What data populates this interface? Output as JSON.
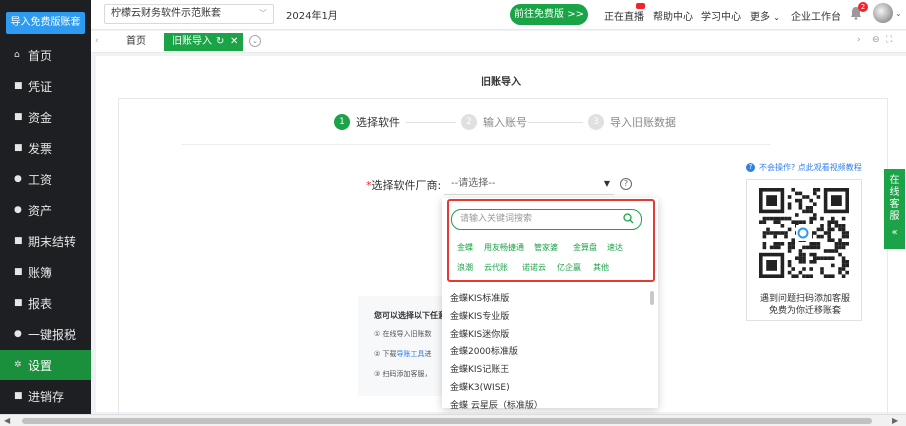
{
  "sidebar": {
    "import_button": "导入免费版账套",
    "items": [
      {
        "label": "首页",
        "icon": "home-icon",
        "glyph": "⌂"
      },
      {
        "label": "凭证",
        "icon": "voucher-icon",
        "glyph": "■"
      },
      {
        "label": "资金",
        "icon": "funds-icon",
        "glyph": "■"
      },
      {
        "label": "发票",
        "icon": "invoice-icon",
        "glyph": "■"
      },
      {
        "label": "工资",
        "icon": "salary-icon",
        "glyph": "●"
      },
      {
        "label": "资产",
        "icon": "assets-icon",
        "glyph": "●"
      },
      {
        "label": "期末结转",
        "icon": "period-end-icon",
        "glyph": "■"
      },
      {
        "label": "账簿",
        "icon": "ledger-icon",
        "glyph": "■"
      },
      {
        "label": "报表",
        "icon": "report-icon",
        "glyph": "■"
      },
      {
        "label": "一键报税",
        "icon": "tax-icon",
        "glyph": "●"
      },
      {
        "label": "设置",
        "icon": "settings-icon",
        "glyph": "✲",
        "active": true
      },
      {
        "label": "进销存",
        "icon": "inventory-icon",
        "glyph": "■"
      }
    ]
  },
  "topbar": {
    "company": "柠檬云财务软件示范账套",
    "period": "2024年1月",
    "free_button": "前往免费版 >>",
    "links": {
      "live": "正在直播",
      "help": "帮助中心",
      "learn": "学习中心",
      "more": "更多",
      "workbench": "企业工作台"
    },
    "notification_count": "2"
  },
  "tabs": {
    "home": "首页",
    "active": "旧账导入"
  },
  "page": {
    "title": "旧账导入",
    "steps": [
      {
        "num": "1",
        "label": "选择软件"
      },
      {
        "num": "2",
        "label": "输入账号"
      },
      {
        "num": "3",
        "label": "导入旧账数据"
      }
    ],
    "field_label": "选择软件厂商:",
    "select_placeholder": "--请选择--",
    "help_link": "不会操作? 点此观看视频教程",
    "qr_caption_1": "遇到问题扫码添加客服",
    "qr_caption_2": "免费为你迁移账套",
    "tips": {
      "title": "您可以选择以下任意",
      "line1": "① 在线导入旧账数",
      "line2_a": "② 下载",
      "line2_link": "导账工具",
      "line2_b": "进",
      "line3": "③ 扫码添加客服，"
    }
  },
  "dropdown": {
    "search_placeholder": "请输入关键词搜索",
    "chips_row1": [
      "金蝶",
      "用友畅捷通",
      "管家婆",
      "金算盘",
      "速达"
    ],
    "chips_row2": [
      "浪潮",
      "云代账",
      "诺诺云",
      "亿企赢",
      "其他"
    ],
    "options": [
      "金蝶KIS标准版",
      "金蝶KIS专业版",
      "金蝶KIS迷你版",
      "金蝶2000标准版",
      "金蝶KIS记账王",
      "金蝶K3(WISE)",
      "金蝶 云星辰（标准版）"
    ]
  },
  "service_tab": {
    "label": "在线客服",
    "chevron": "«"
  },
  "colors": {
    "brand_green": "#1ba347",
    "sidebar_bg": "#1d1f22",
    "accent_blue": "#2f9bf0",
    "highlight_red": "#e53935"
  }
}
